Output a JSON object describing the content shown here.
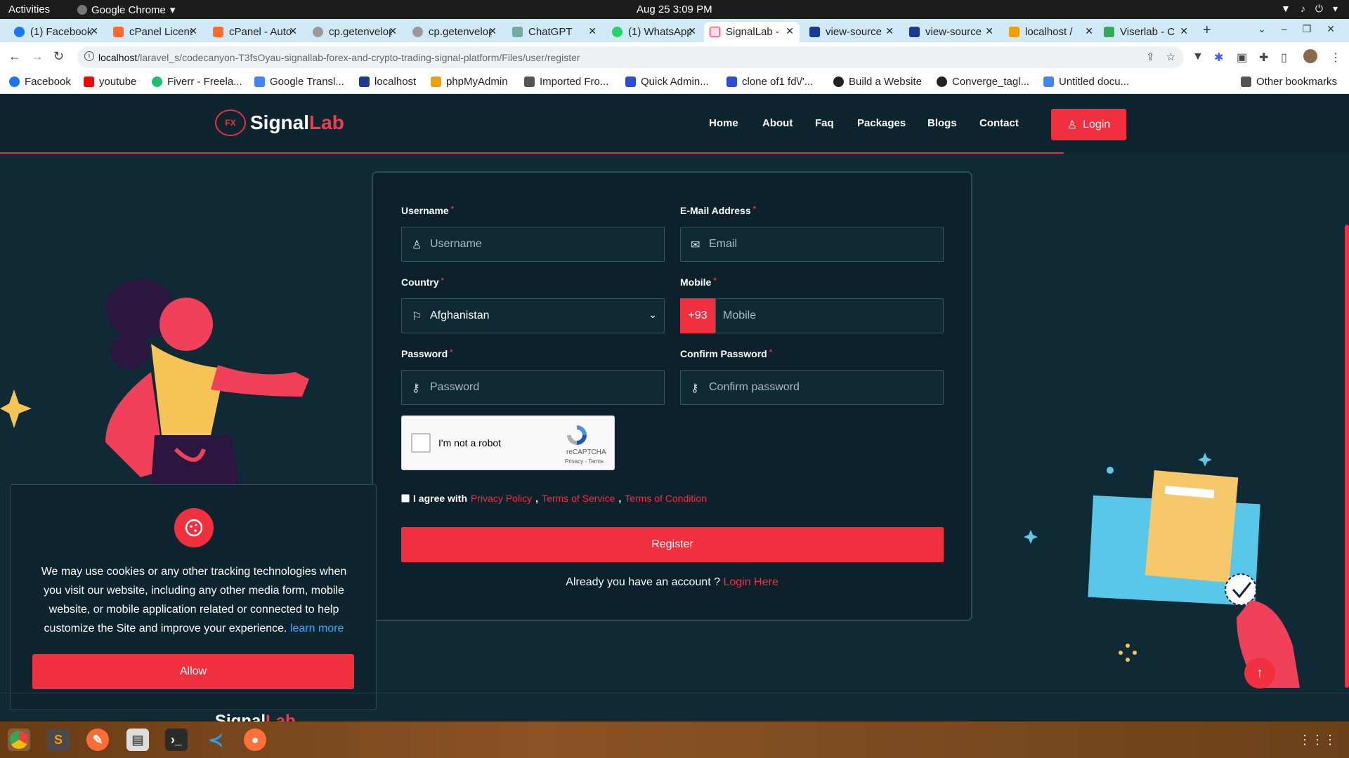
{
  "os": {
    "activities": "Activities",
    "app_name": "Google Chrome",
    "clock": "Aug 25  3:09 PM"
  },
  "browser": {
    "tabs": [
      {
        "label": "(1) Facebook",
        "color": "#1877f2"
      },
      {
        "label": "cPanel License",
        "color": "#ff6c2c"
      },
      {
        "label": "cPanel - Auto",
        "color": "#ff6c2c"
      },
      {
        "label": "cp.getenvelope",
        "color": "#888888"
      },
      {
        "label": "cp.getenvelope",
        "color": "#888888"
      },
      {
        "label": "ChatGPT",
        "color": "#74aa9c"
      },
      {
        "label": "(1) WhatsApp",
        "color": "#25d366"
      },
      {
        "label": "SignalLab -",
        "color": "#f0303e"
      },
      {
        "label": "view-source",
        "color": "#1a3a8f"
      },
      {
        "label": "view-source",
        "color": "#1a3a8f"
      },
      {
        "label": "localhost /",
        "color": "#f0a000"
      },
      {
        "label": "Viserlab - C",
        "color": "#34a853"
      }
    ],
    "url_host": "localhost",
    "url_path": "/laravel_s/codecanyon-T3fsOyau-signallab-forex-and-crypto-trading-signal-platform/Files/user/register",
    "bookmarks": [
      "Facebook",
      "youtube",
      "Fiverr - Freela...",
      "Google Transl...",
      "localhost",
      "phpMyAdmin",
      "Imported Fro...",
      "Quick Admin...",
      "clone of1 fd\\/'...",
      "Build a Website",
      "Converge_tagl...",
      "Untitled docu..."
    ],
    "other_bookmarks": "Other bookmarks"
  },
  "site": {
    "brand_first": "Signal",
    "brand_second": "Lab",
    "brand_badge": "FX",
    "nav": [
      "Home",
      "About",
      "Faq",
      "Packages",
      "Blogs",
      "Contact"
    ],
    "login_label": "Login",
    "accent": "#f0303e"
  },
  "form": {
    "username_label": "Username",
    "username_placeholder": "Username",
    "email_label": "E-Mail Address",
    "email_placeholder": "Email",
    "country_label": "Country",
    "country_value": "Afghanistan",
    "mobile_label": "Mobile",
    "mobile_prefix": "+93",
    "mobile_placeholder": "Mobile",
    "password_label": "Password",
    "password_placeholder": "Password",
    "confirm_label": "Confirm Password",
    "confirm_placeholder": "Confirm password",
    "required_mark": "*",
    "captcha_text": "I'm not a robot",
    "captcha_brand": "reCAPTCHA",
    "captcha_links": "Privacy - Terms",
    "agree_text": "I agree with",
    "privacy": "Privacy Policy",
    "terms_service": "Terms of Service",
    "terms_condition": "Terms of Condition",
    "register_label": "Register",
    "already_text": "Already you have an account ?",
    "login_here": "Login Here"
  },
  "cookie": {
    "text": "We may use cookies or any other tracking technologies when you visit our website, including any other media form, mobile website, or mobile application related or connected to help customize the Site and improve your experience.",
    "learn_more": "learn more",
    "allow_label": "Allow"
  },
  "taskbar": [
    "chrome",
    "sublime-text",
    "postman",
    "files",
    "terminal",
    "vscode",
    "firefox"
  ]
}
